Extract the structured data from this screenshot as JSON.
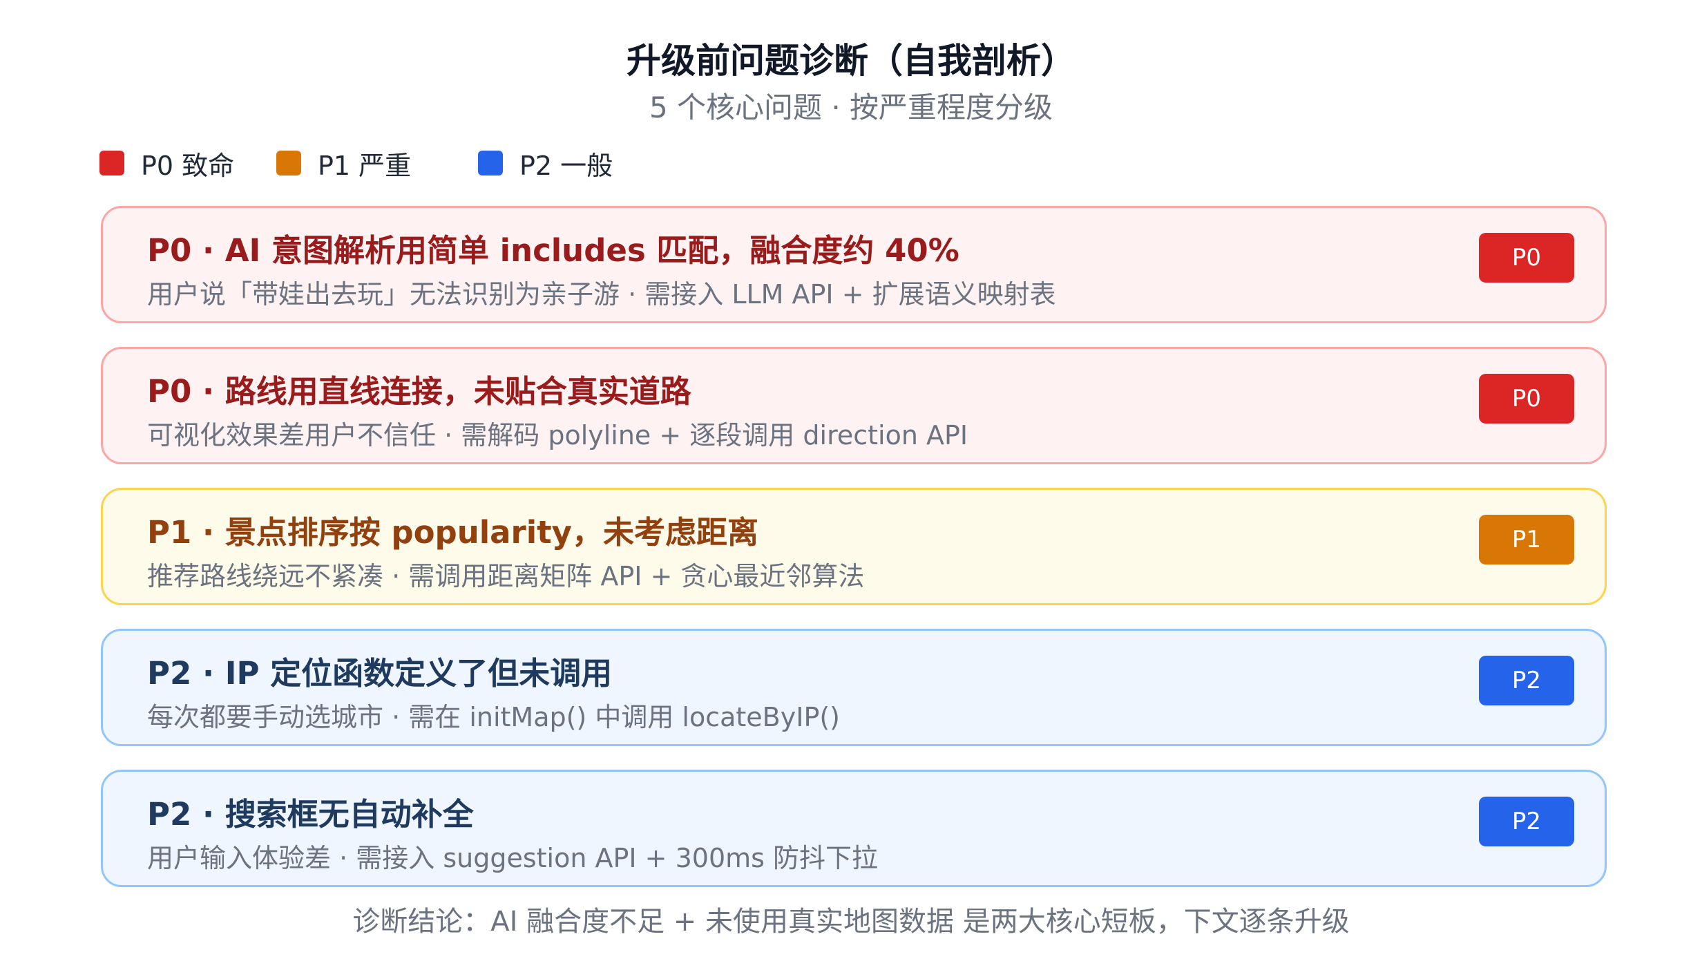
{
  "header": {
    "title": "升级前问题诊断（自我剖析）",
    "subtitle": "5 个核心问题 · 按严重程度分级"
  },
  "legend": [
    {
      "label": "P0 致命",
      "color": "#dc2626"
    },
    {
      "label": "P1 严重",
      "color": "#d97706"
    },
    {
      "label": "P2 一般",
      "color": "#2563eb"
    }
  ],
  "issues": [
    {
      "title": "P0 · AI 意图解析用简单 includes 匹配，融合度约 40%",
      "desc": "用户说「带娃出去玩」无法识别为亲子游 · 需接入 LLM API + 扩展语义映射表",
      "badge": "P0",
      "level": "P0",
      "colors": {
        "bg": "#fef2f2",
        "border": "#fca5a5",
        "title": "#991b1b",
        "badge": "#dc2626"
      }
    },
    {
      "title": "P0 · 路线用直线连接，未贴合真实道路",
      "desc": "可视化效果差用户不信任 · 需解码 polyline + 逐段调用 direction API",
      "badge": "P0",
      "level": "P0",
      "colors": {
        "bg": "#fef2f2",
        "border": "#fca5a5",
        "title": "#991b1b",
        "badge": "#dc2626"
      }
    },
    {
      "title": "P1 · 景点排序按 popularity，未考虑距离",
      "desc": "推荐路线绕远不紧凑 · 需调用距离矩阵 API + 贪心最近邻算法",
      "badge": "P1",
      "level": "P1",
      "colors": {
        "bg": "#fffbeb",
        "border": "#fcd34d",
        "title": "#92400e",
        "badge": "#d97706"
      }
    },
    {
      "title": "P2 · IP 定位函数定义了但未调用",
      "desc": "每次都要手动选城市 · 需在 initMap() 中调用 locateByIP()",
      "badge": "P2",
      "level": "P2",
      "colors": {
        "bg": "#eff6ff",
        "border": "#93c5fd",
        "title": "#1e3a5f",
        "badge": "#2563eb"
      }
    },
    {
      "title": "P2 · 搜索框无自动补全",
      "desc": "用户输入体验差 · 需接入 suggestion API + 300ms 防抖下拉",
      "badge": "P2",
      "level": "P2",
      "colors": {
        "bg": "#eff6ff",
        "border": "#93c5fd",
        "title": "#1e3a5f",
        "badge": "#2563eb"
      }
    }
  ],
  "footer": {
    "text": "诊断结论：AI 融合度不足 + 未使用真实地图数据 是两大核心短板，下文逐条升级"
  }
}
